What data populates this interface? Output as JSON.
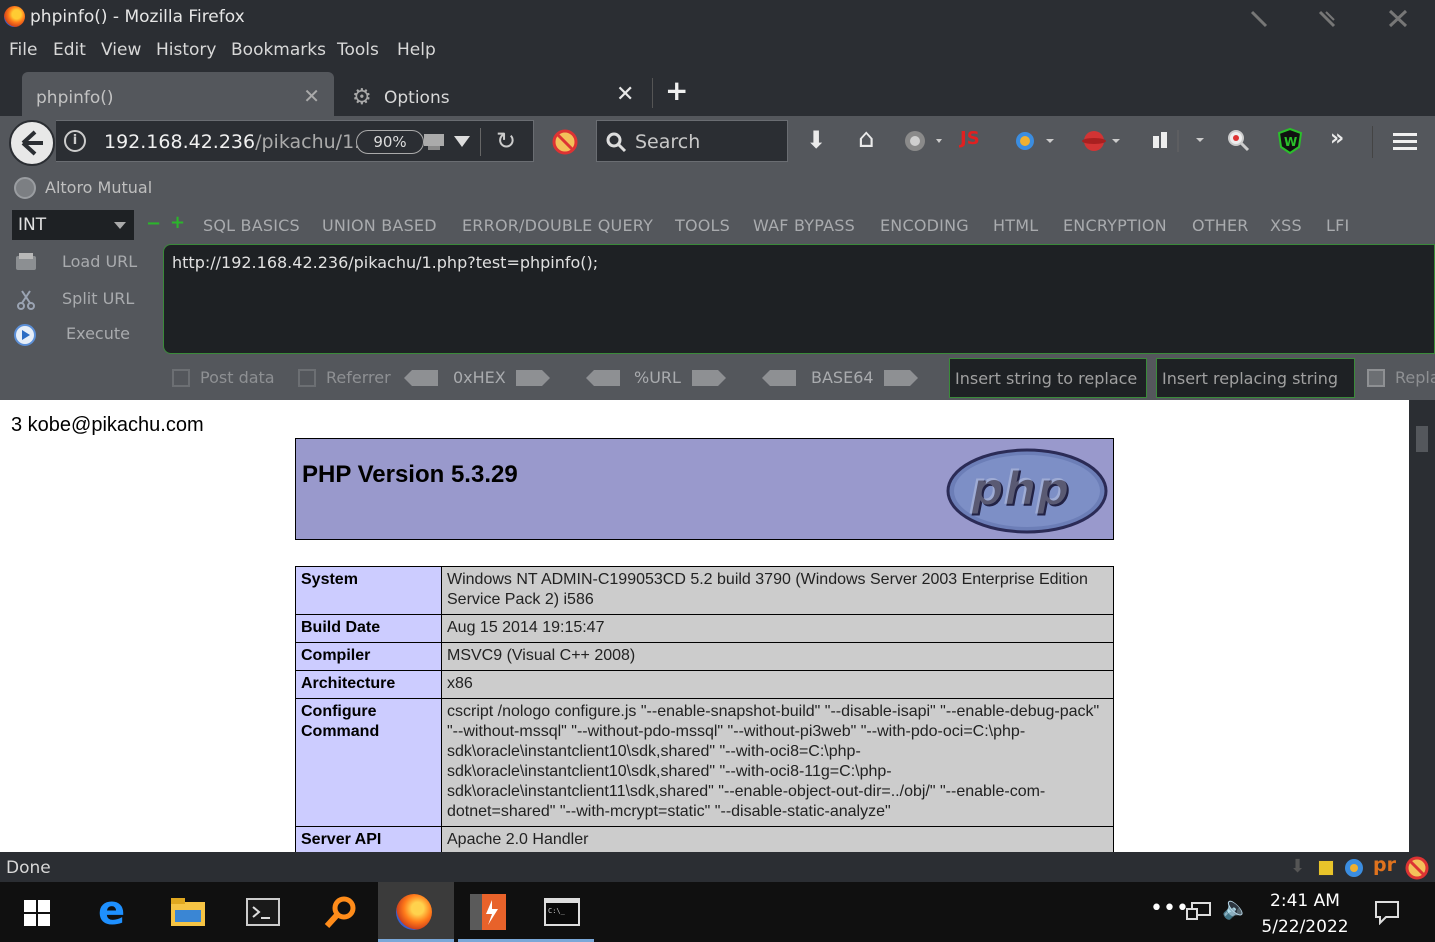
{
  "window": {
    "title": "phpinfo() - Mozilla Firefox"
  },
  "menu": [
    "File",
    "Edit",
    "View",
    "History",
    "Bookmarks",
    "Tools",
    "Help"
  ],
  "tabs": [
    {
      "label": "phpinfo()",
      "active": true
    },
    {
      "label": "Options",
      "active": false
    }
  ],
  "navbar": {
    "url_host": "192.168.42.236",
    "url_path": "/pikachu/1.",
    "zoom": "90%",
    "search_placeholder": "Search"
  },
  "bookmarks": [
    {
      "label": "Altoro Mutual"
    }
  ],
  "hackbar": {
    "select_value": "INT",
    "menus": [
      "SQL BASICS",
      "UNION BASED",
      "ERROR/DOUBLE QUERY",
      "TOOLS",
      "WAF BYPASS",
      "ENCODING",
      "HTML",
      "ENCRYPTION",
      "OTHER",
      "XSS",
      "LFI"
    ],
    "load_url": "Load URL",
    "split_url": "Split URL",
    "execute": "Execute",
    "url_value": "http://192.168.42.236/pikachu/1.php?test=phpinfo();",
    "post_data": "Post data",
    "referrer": "Referrer",
    "hex": "0xHEX",
    "urlenc": "%URL",
    "base64": "BASE64",
    "insert_string_placeholder": "Insert string to replace",
    "insert_replacing_placeholder": "Insert replacing string",
    "replace_label": "Repla"
  },
  "page": {
    "echo": "3 kobe@pikachu.com",
    "php_version": "PHP Version 5.3.29",
    "info_rows": [
      {
        "key": "System",
        "value": "Windows NT ADMIN-C199053CD 5.2 build 3790 (Windows Server 2003 Enterprise Edition Service Pack 2) i586"
      },
      {
        "key": "Build Date",
        "value": "Aug 15 2014 19:15:47"
      },
      {
        "key": "Compiler",
        "value": "MSVC9 (Visual C++ 2008)"
      },
      {
        "key": "Architecture",
        "value": "x86"
      },
      {
        "key": "Configure Command",
        "value": "cscript /nologo configure.js \"--enable-snapshot-build\" \"--disable-isapi\" \"--enable-debug-pack\" \"--without-mssql\" \"--without-pdo-mssql\" \"--without-pi3web\" \"--with-pdo-oci=C:\\php-sdk\\oracle\\instantclient10\\sdk,shared\" \"--with-oci8=C:\\php-sdk\\oracle\\instantclient10\\sdk,shared\" \"--with-oci8-11g=C:\\php-sdk\\oracle\\instantclient11\\sdk,shared\" \"--enable-object-out-dir=../obj/\" \"--enable-com-dotnet=shared\" \"--with-mcrypt=static\" \"--disable-static-analyze\""
      },
      {
        "key": "Server API",
        "value": "Apache 2.0 Handler"
      },
      {
        "key": "",
        "value": ""
      }
    ]
  },
  "status": {
    "text": "Done"
  },
  "taskbar": {
    "time": "2:41 AM",
    "date": "5/22/2022"
  }
}
